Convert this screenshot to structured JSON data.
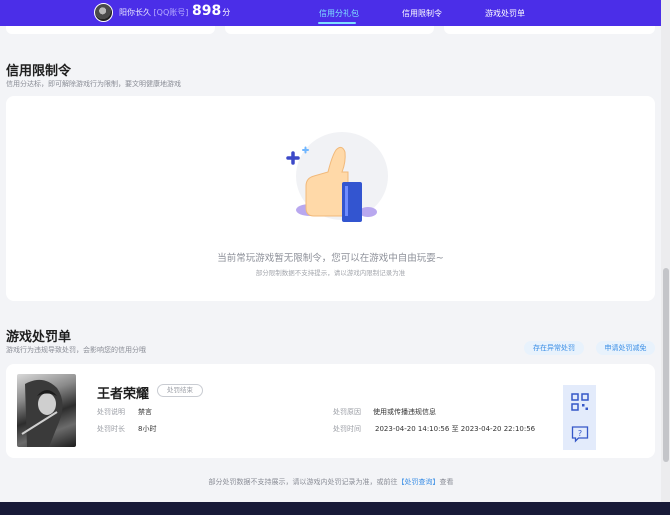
{
  "header": {
    "nickname": "阳你长久",
    "account_tag": "[QQ账号]",
    "score": "898",
    "score_unit": "分",
    "tabs": [
      {
        "label": "信用分礼包",
        "active": true
      },
      {
        "label": "信用限制令",
        "active": false
      },
      {
        "label": "游戏处罚单",
        "active": false
      }
    ]
  },
  "restriction": {
    "title": "信用限制令",
    "subtitle": "信用分达标，即可解除游戏行为限制，要文明健康地游戏",
    "empty_main": "当前常玩游戏暂无限制令，您可以在游戏中自由玩耍~",
    "empty_sub": "部分限制数据不支持提示，请以游戏内限制记录为准",
    "illustration_icon": "thumbs-up-icon"
  },
  "penalty": {
    "title": "游戏处罚单",
    "subtitle": "游戏行为违规导致处罚，会影响您的信用分哦",
    "buttons": {
      "appeal": "存在异常处罚",
      "reduce": "申请处罚减免"
    },
    "record": {
      "game_name": "王者荣耀",
      "status": "处罚结束",
      "desc_label": "处罚说明",
      "desc_value": "禁言",
      "duration_label": "处罚时长",
      "duration_value": "8小时",
      "reason_label": "处罚原因",
      "reason_value": "使用或传播违规信息",
      "time_label": "处罚时间",
      "time_value": "2023-04-20 14:10:56 至 2023-04-20 22:10:56",
      "qr_icon": "qr-code-icon",
      "help_icon": "help-chat-icon"
    },
    "footnote_text": "部分处罚数据不支持展示，请以游戏内处罚记录为准，或前往",
    "footnote_link": "【处罚查询】",
    "footnote_tail": "查看"
  },
  "colors": {
    "nav_bg": "#4b2ee8",
    "active_tab": "#7fe0ff",
    "link": "#3a8ee6",
    "footer_bg": "#181a38"
  }
}
